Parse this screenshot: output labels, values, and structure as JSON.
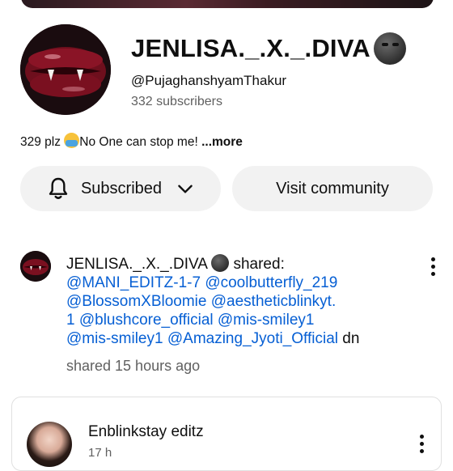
{
  "channel": {
    "name": "JENLISA._.X._.DIVA",
    "handle": "@PujaghanshyamThakur",
    "subscribers": "332 subscribers",
    "description_prefix": "329 plz",
    "description_text": "No One can stop me!",
    "description_more": "...more"
  },
  "actions": {
    "subscribe_label": "Subscribed",
    "community_label": "Visit community"
  },
  "post": {
    "author": "JENLISA._.X._.DIVA",
    "verb": "shared:",
    "mentions_line1": [
      "@MANI_EDITZ-1-7",
      "@coolbutterfly_219"
    ],
    "mentions_line2": [
      "@BlossomXBloomie",
      "@aestheticblinkyt."
    ],
    "mentions_line3": [
      "1",
      "@blushcore_official",
      "@mis-smiley1"
    ],
    "mentions_line4": [
      "@mis-smiley1",
      "@Amazing_Jyoti_Official"
    ],
    "suffix": "dn",
    "time": "shared 15 hours ago"
  },
  "next_card": {
    "author": "Enblinkstay editz",
    "time": "17 h"
  },
  "icons": {
    "bell": "bell-icon",
    "chevron": "chevron-down-icon",
    "more": "more-vert-icon"
  },
  "colors": {
    "link": "#065fd4",
    "secondary_text": "#606060",
    "button_bg": "#f2f2f2"
  }
}
